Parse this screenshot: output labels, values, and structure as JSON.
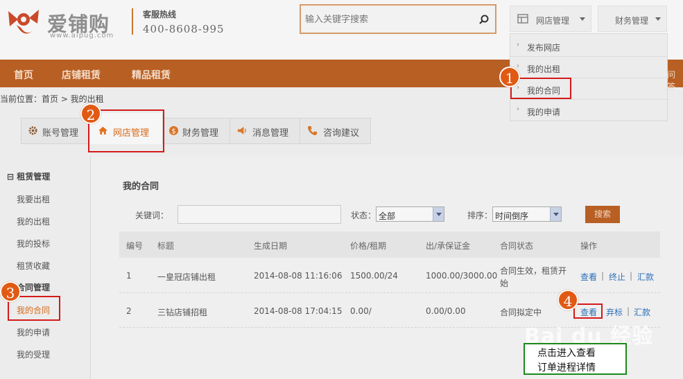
{
  "header": {
    "logo_text": "爱铺购",
    "logo_url": "www.aipug.com",
    "hotline_label": "客服热线",
    "hotline_number": "400-8608-995",
    "search_placeholder": "输入关键字搜索",
    "dropdowns": [
      {
        "label": "网店管理"
      },
      {
        "label": "财务管理"
      }
    ]
  },
  "nav": {
    "items": [
      {
        "label": "首页"
      },
      {
        "label": "店铺租赁"
      },
      {
        "label": "精品租赁"
      }
    ],
    "edge_text": "问答"
  },
  "dropdown_menu": {
    "items": [
      {
        "label": "发布网店"
      },
      {
        "label": "我的出租"
      },
      {
        "label": "我的合同"
      },
      {
        "label": "我的申请"
      }
    ]
  },
  "breadcrumb": "当前位置：首页 > 我的出租",
  "tabs": [
    {
      "label": "账号管理"
    },
    {
      "label": "网店管理"
    },
    {
      "label": "财务管理"
    },
    {
      "label": "消息管理"
    },
    {
      "label": "咨询建议"
    }
  ],
  "sidebar": {
    "group1": "⊟ 租赁管理",
    "group1_items": [
      "我要出租",
      "我的出租",
      "我的投标",
      "租赁收藏"
    ],
    "group2": "合同管理",
    "group2_items": [
      "我的合同",
      "我的申请",
      "我的受理"
    ]
  },
  "content": {
    "title": "我的合同",
    "filters": {
      "keyword_label": "关键词：",
      "status_label": "状态：",
      "status_value": "全部",
      "sort_label": "排序：",
      "sort_value": "时间倒序",
      "search_button": "搜索"
    },
    "columns": [
      "编号",
      "标题",
      "生成日期",
      "价格/租期",
      "出/承保证金",
      "合同状态",
      "操作"
    ],
    "rows": [
      {
        "id": "1",
        "title": "一皇冠店铺出租",
        "date": "2014-08-08 11:16:06",
        "price": "1500.00/24",
        "deposit": "1000.00/3000.00",
        "status_line1": "合同生效，租赁开",
        "status_line2": "始",
        "actions": [
          "查看",
          "终止",
          "汇款"
        ]
      },
      {
        "id": "2",
        "title": "三钻店铺招租",
        "date": "2014-08-08 17:04:15",
        "price": "0.00/",
        "deposit": "0.00/0.00",
        "status_line1": "合同拟定中",
        "status_line2": "",
        "actions": [
          "查看",
          "弃标",
          "汇款"
        ]
      }
    ]
  },
  "annotations": {
    "markers": [
      "1",
      "2",
      "3",
      "4"
    ],
    "callout_line1": "点击进入查看",
    "callout_line2": "订单进程详情",
    "watermark": "Bai du 经验"
  },
  "colors": {
    "brand_orange": "#b85f24",
    "highlight_red": "#d51919",
    "marker_orange": "#e05a14",
    "link_blue": "#2b6fb8",
    "callout_green": "#1a8a1a"
  }
}
